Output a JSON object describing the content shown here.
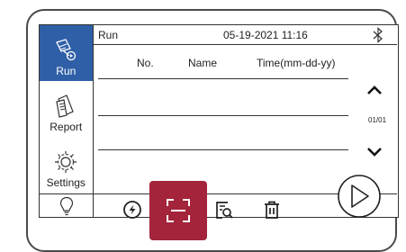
{
  "sidebar": {
    "items": [
      {
        "label": "Run",
        "icon": "run-document-icon",
        "active": true
      },
      {
        "label": "Report",
        "icon": "report-documents-icon",
        "active": false
      },
      {
        "label": "Settings",
        "icon": "gear-icon",
        "active": false
      }
    ]
  },
  "header": {
    "mode": "Run",
    "datetime": "05-19-2021 11:16",
    "bluetooth_icon": "bluetooth-icon"
  },
  "table": {
    "columns": [
      "No.",
      "Name",
      "Time(mm-dd-yy)"
    ],
    "rows": []
  },
  "pager": {
    "page": "01/01"
  },
  "toolbar": {
    "items": [
      "lightbulb-icon",
      "flash-icon",
      "scan-icon",
      "search-document-icon",
      "trash-icon",
      "play-icon"
    ]
  },
  "colors": {
    "accent": "#2f5fa7",
    "scan_button": "#a3243b"
  }
}
